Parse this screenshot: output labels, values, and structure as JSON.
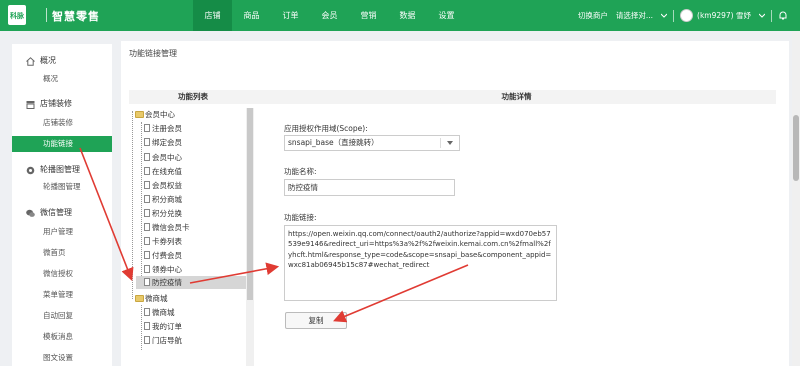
{
  "brand": {
    "logo_text": "科脉",
    "logo_sub": "KEMAI",
    "name": "智慧零售"
  },
  "nav": [
    "店铺",
    "商品",
    "订单",
    "会员",
    "营销",
    "数据",
    "设置"
  ],
  "nav_active_index": 0,
  "header_right": {
    "switch_merchant": "切换商户",
    "select_placeholder": "请选择对...",
    "user": "(km9297) 雪妤"
  },
  "sidebar": {
    "groups": [
      {
        "label": "概况",
        "icon": "home-icon",
        "items": [
          "概况"
        ]
      },
      {
        "label": "店铺装修",
        "icon": "shop-icon",
        "items": [
          "店铺装修",
          "功能链接"
        ]
      },
      {
        "label": "轮播图管理",
        "icon": "carousel-icon",
        "items": [
          "轮播图管理"
        ]
      },
      {
        "label": "微信管理",
        "icon": "wechat-icon",
        "items": [
          "用户管理",
          "微首页",
          "微信授权",
          "菜单管理",
          "自动回复",
          "模板消息",
          "图文设置"
        ]
      }
    ],
    "active_item": "功能链接"
  },
  "page": {
    "title": "功能链接管理",
    "list_header": "功能列表",
    "detail_header": "功能详情"
  },
  "tree": {
    "group1": "会员中心",
    "group1_items": [
      "注册会员",
      "绑定会员",
      "会员中心",
      "在线充值",
      "会员权益",
      "积分商城",
      "积分兑换",
      "微信会员卡",
      "卡券列表",
      "付费会员",
      "领券中心",
      "防控疫情"
    ],
    "group2": "微商城",
    "group2_items": [
      "微商城",
      "我的订单",
      "门店导航"
    ],
    "selected": "防控疫情"
  },
  "form": {
    "scope_label": "应用授权作用域(Scope):",
    "scope_value": "snsapi_base（直接跳转）",
    "name_label": "功能名称:",
    "name_value": "防控疫情",
    "link_label": "功能链接:",
    "link_value": "https://open.weixin.qq.com/connect/oauth2/authorize?appid=wxd070eb57539e9146&redirect_uri=https%3a%2f%2fweixin.kemai.com.cn%2fmall%2fyhcft.html&response_type=code&scope=snsapi_base&component_appid=wxc81ab06945b15c87#wechat_redirect",
    "copy_label": "复制"
  },
  "colors": {
    "accent": "#1fa356",
    "accent_dark": "#158c47",
    "arrow": "#e03b33"
  }
}
